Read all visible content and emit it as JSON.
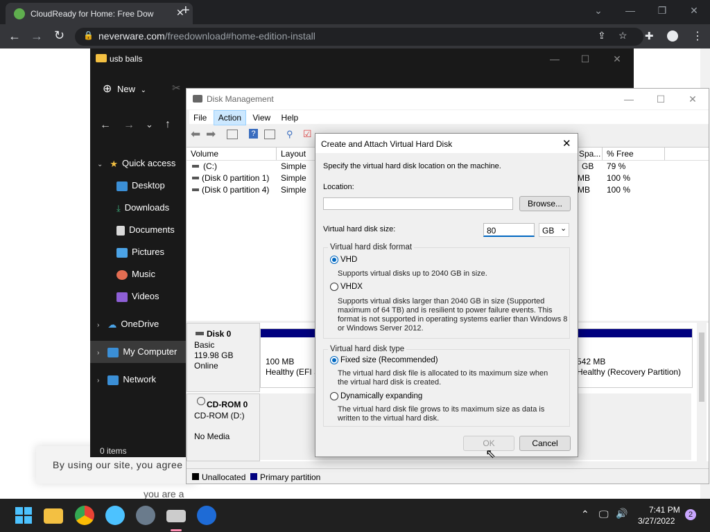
{
  "browser": {
    "tab_title": "CloudReady for Home: Free Dow",
    "url_domain": "neverware.com",
    "url_path": "/freedownload#home-edition-install",
    "new_tab": "+"
  },
  "webpage": {
    "cookie_text": "By using our site, you agree",
    "partial_text": "you are a"
  },
  "explorer": {
    "title": "usb balls",
    "new_label": "New",
    "status": "0 items",
    "nav": {
      "quick_access": "Quick access",
      "desktop": "Desktop",
      "downloads": "Downloads",
      "documents": "Documents",
      "pictures": "Pictures",
      "music": "Music",
      "videos": "Videos",
      "onedrive": "OneDrive",
      "my_computer": "My Computer",
      "network": "Network"
    }
  },
  "disk_mgmt": {
    "title": "Disk Management",
    "menu": [
      "File",
      "Action",
      "View",
      "Help"
    ],
    "columns": {
      "volume": "Volume",
      "layout": "Layout",
      "spa": "Spa...",
      "free": "% Free"
    },
    "volumes": [
      {
        "name": "(C:)",
        "layout": "Simple",
        "spa": "GB",
        "free": "79 %"
      },
      {
        "name": "(Disk 0 partition 1)",
        "layout": "Simple",
        "spa": "MB",
        "free": "100 %"
      },
      {
        "name": "(Disk 0 partition 4)",
        "layout": "Simple",
        "spa": "MB",
        "free": "100 %"
      }
    ],
    "disk0": {
      "name": "Disk 0",
      "type": "Basic",
      "size": "119.98 GB",
      "status": "Online"
    },
    "part1": {
      "size": "100 MB",
      "status": "Healthy (EFI S"
    },
    "part4": {
      "size": "542 MB",
      "status": "Healthy (Recovery Partition)"
    },
    "cdrom": {
      "name": "CD-ROM 0",
      "drive": "CD-ROM (D:)",
      "media": "No Media"
    },
    "legend": {
      "unallocated": "Unallocated",
      "primary": "Primary partition"
    }
  },
  "dialog": {
    "title": "Create and Attach Virtual Hard Disk",
    "instruction": "Specify the virtual hard disk location on the machine.",
    "location_label": "Location:",
    "location_value": "",
    "browse": "Browse...",
    "size_label": "Virtual hard disk size:",
    "size_value": "80",
    "unit": "GB",
    "format_group": "Virtual hard disk format",
    "vhd": "VHD",
    "vhd_desc": "Supports virtual disks up to 2040 GB in size.",
    "vhdx": "VHDX",
    "vhdx_desc": "Supports virtual disks larger than 2040 GB in size (Supported maximum of 64 TB) and is resilient to power failure events. This format is not supported in operating systems earlier than Windows 8 or Windows Server 2012.",
    "type_group": "Virtual hard disk type",
    "fixed": "Fixed size (Recommended)",
    "fixed_desc": "The virtual hard disk file is allocated to its maximum size when the virtual hard disk is created.",
    "dynamic": "Dynamically expanding",
    "dynamic_desc": "The virtual hard disk file grows to its maximum size as data is written to the virtual hard disk.",
    "ok": "OK",
    "cancel": "Cancel"
  },
  "taskbar": {
    "time": "7:41 PM",
    "date": "3/27/2022",
    "notifications": "2"
  }
}
